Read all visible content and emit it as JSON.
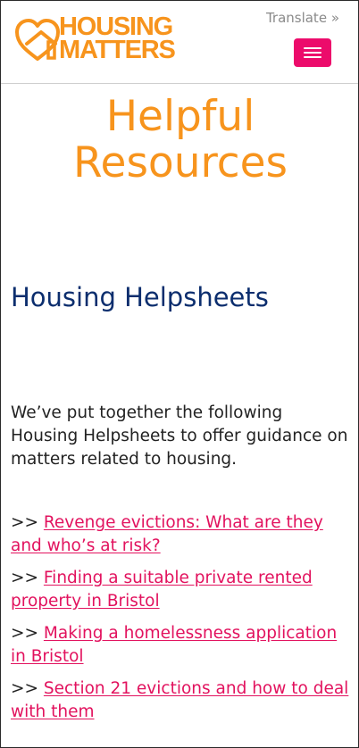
{
  "header": {
    "logo": {
      "line1": "HOUSING",
      "line2": "MATTERS"
    },
    "translate_label": "Translate »",
    "menu_icon": "hamburger-icon"
  },
  "main": {
    "page_title_line1": "Helpful",
    "page_title_line2": "Resources",
    "section_title": "Housing Helpsheets",
    "intro": "We’ve put together the following Housing Helpsheets to offer guidance on matters related to housing.",
    "links": [
      {
        "prefix": ">> ",
        "label": "Revenge evictions: What are they and who’s at risk?"
      },
      {
        "prefix": ">> ",
        "label": "Finding a suitable private rented property in Bristol"
      },
      {
        "prefix": ">> ",
        "label": "Making a homelessness application in Bristol"
      },
      {
        "prefix": ">> ",
        "label": "Section 21 evictions and how to deal with them"
      }
    ]
  },
  "colors": {
    "brand_orange": "#f7941d",
    "accent_pink": "#ec0b6b",
    "link_pink": "#e2125e",
    "heading_navy": "#0c2e6e"
  }
}
